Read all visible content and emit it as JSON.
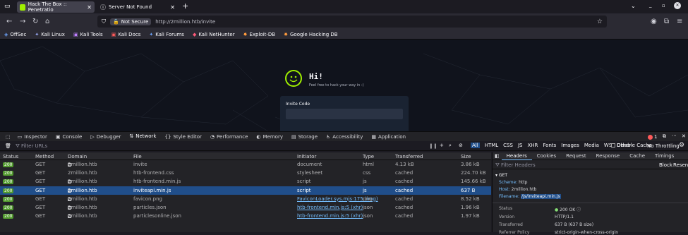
{
  "tabs": [
    {
      "title": "Hack The Box :: Penetratio",
      "active": true
    },
    {
      "title": "Server Not Found",
      "active": false
    }
  ],
  "nav": {
    "security_label": "Not Secure",
    "url": "http://2million.htb/invite"
  },
  "bookmarks": [
    "OffSec",
    "Kali Linux",
    "Kali Tools",
    "Kali Docs",
    "Kali Forums",
    "Kali NetHunter",
    "Exploit-DB",
    "Google Hacking DB"
  ],
  "page": {
    "heading": "Hi!",
    "subheading": "Feel free to hack your way in :)",
    "invite_label": "Invite Code"
  },
  "devtools": {
    "tabs": [
      "Inspector",
      "Console",
      "Debugger",
      "Network",
      "Style Editor",
      "Performance",
      "Memory",
      "Storage",
      "Accessibility",
      "Application"
    ],
    "active_tab": "Network",
    "error_count": "1",
    "filter_placeholder": "Filter URLs",
    "type_filters": [
      "All",
      "HTML",
      "CSS",
      "JS",
      "XHR",
      "Fonts",
      "Images",
      "Media",
      "WS",
      "Other"
    ],
    "disable_cache": "Disable Cache",
    "throttling": "No Throttling",
    "columns": [
      "Status",
      "Method",
      "Domain",
      "File",
      "Initiator",
      "Type",
      "Transferred",
      "Size"
    ],
    "requests": [
      {
        "status": "200",
        "method": "GET",
        "domain": "2million.htb",
        "file": "invite",
        "initiator": "document",
        "type": "html",
        "transferred": "4.13 kB",
        "size": "3.86 kB",
        "lock": true
      },
      {
        "status": "200",
        "method": "GET",
        "domain": "2million.htb",
        "file": "htb-frontend.css",
        "initiator": "stylesheet",
        "type": "css",
        "transferred": "cached",
        "size": "224.70 kB",
        "lock": false
      },
      {
        "status": "200",
        "method": "GET",
        "domain": "2million.htb",
        "file": "htb-frontend.min.js",
        "initiator": "script",
        "type": "js",
        "transferred": "cached",
        "size": "145.66 kB",
        "lock": true
      },
      {
        "status": "200",
        "method": "GET",
        "domain": "2million.htb",
        "file": "inviteapi.min.js",
        "initiator": "script",
        "type": "js",
        "transferred": "cached",
        "size": "637 B",
        "lock": true
      },
      {
        "status": "200",
        "method": "GET",
        "domain": "2million.htb",
        "file": "favicon.png",
        "initiator": "FaviconLoader.sys.mjs:175 (img)",
        "type": "png",
        "transferred": "cached",
        "size": "8.52 kB",
        "lock": true
      },
      {
        "status": "200",
        "method": "GET",
        "domain": "2million.htb",
        "file": "particles.json",
        "initiator": "htb-frontend.min.js:5 (xhr)",
        "type": "json",
        "transferred": "cached",
        "size": "1.96 kB",
        "lock": true
      },
      {
        "status": "200",
        "method": "GET",
        "domain": "2million.htb",
        "file": "particlesonline.json",
        "initiator": "htb-frontend.min.js:5 (xhr)",
        "type": "json",
        "transferred": "cached",
        "size": "1.97 kB",
        "lock": true
      }
    ],
    "details": {
      "tabs": [
        "Headers",
        "Cookies",
        "Request",
        "Response",
        "Cache",
        "Timings"
      ],
      "filter_placeholder": "Filter Headers",
      "block_label": "Block",
      "resend_label": "Resend",
      "method": "GET",
      "scheme_key": "Scheme:",
      "scheme": "http",
      "host_key": "Host:",
      "host": "2million.htb",
      "filename_key": "Filename:",
      "filename": "/js/inviteapi.min.js",
      "status_key": "Status",
      "status": "200 OK",
      "version_key": "Version",
      "version": "HTTP/1.1",
      "transferred_key": "Transferred",
      "transferred": "637 B (637 B size)",
      "referrer_key": "Referrer Policy",
      "referrer": "strict-origin-when-cross-origin"
    }
  }
}
